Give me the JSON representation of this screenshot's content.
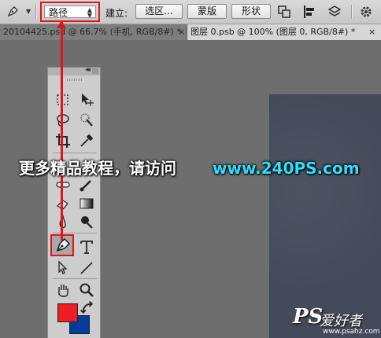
{
  "optionbar": {
    "mode_value": "路径",
    "build_label": "建立:",
    "selection_button": "选区...",
    "mask_button": "蒙版",
    "shape_button": "形状"
  },
  "tabs": [
    {
      "label": "20104425.psd @ 66.7% (手机, RGB/8#) *",
      "close": "×"
    },
    {
      "label": "图层 0.psb @ 100% (图层 0, RGB/8#) *",
      "close": "×"
    }
  ],
  "toolbox": {
    "collapse": "◂◂",
    "tools": [
      "marquee",
      "move",
      "lasso",
      "quick-select",
      "crop",
      "eyedropper",
      "healing",
      "brush",
      "stamp",
      "history-brush",
      "eraser",
      "gradient",
      "blur",
      "dodge",
      "pen",
      "type",
      "path-select",
      "line",
      "hand",
      "zoom"
    ]
  },
  "colors": {
    "foreground": "#ee1c24",
    "background": "#003c9b",
    "highlight": "#e0141b"
  },
  "watermark": {
    "text_cn": "更多精品教程，请访问",
    "text_url": "www.240PS.com"
  },
  "logo": {
    "ps": "PS",
    "cn": "爱好者",
    "url": "www.psahz.com"
  }
}
